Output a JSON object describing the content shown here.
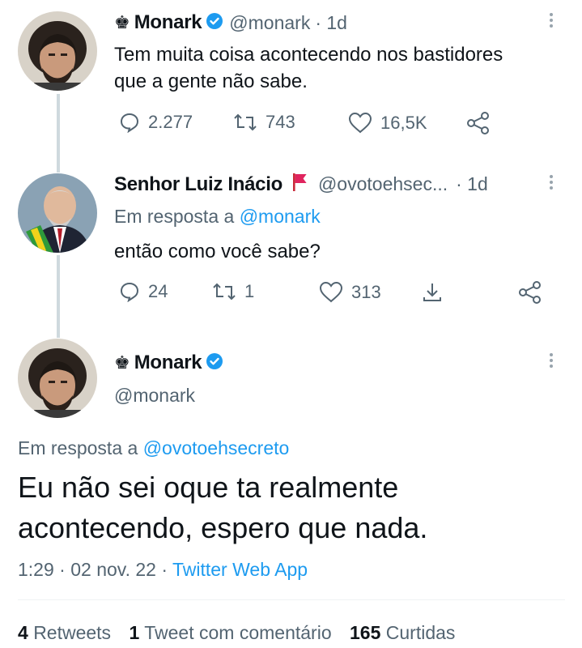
{
  "colors": {
    "text": "#0f1419",
    "muted": "#536471",
    "link": "#1d9bf0",
    "verified": "#1d9bf0",
    "flag": "#e0245e"
  },
  "tweets": [
    {
      "name": "Monark",
      "prefix_icon": "chess-king-icon",
      "handle": "@monark",
      "time": "· 1d",
      "text_line1": "Tem muita coisa acontecendo nos bastidores",
      "text_line2": "que a gente não sabe.",
      "replies": "2.277",
      "retweets": "743",
      "likes": "16,5K"
    },
    {
      "name": "Senhor Luiz Inácio",
      "suffix_icon": "red-flag-icon",
      "handle": "@ovotoehsec...",
      "time": "· 1d",
      "reply_prefix": "Em resposta a",
      "reply_to": "@monark",
      "text": "então como você sabe?",
      "replies": "24",
      "retweets": "1",
      "likes": "313"
    }
  ],
  "main": {
    "name": "Monark",
    "handle": "@monark",
    "reply_prefix": "Em resposta a",
    "reply_to": "@ovotoehsecreto",
    "text_line1": "Eu não sei oque ta realmente",
    "text_line2": "acontecendo, espero que nada.",
    "time": "1:29",
    "sep1": "·",
    "date": "02 nov. 22",
    "sep2": "·",
    "source": "Twitter Web App"
  },
  "stats": {
    "retweets_count": "4",
    "retweets_label": "Retweets",
    "quotes_count": "1",
    "quotes_label": "Tweet com comentário",
    "likes_count": "165",
    "likes_label": "Curtidas"
  }
}
